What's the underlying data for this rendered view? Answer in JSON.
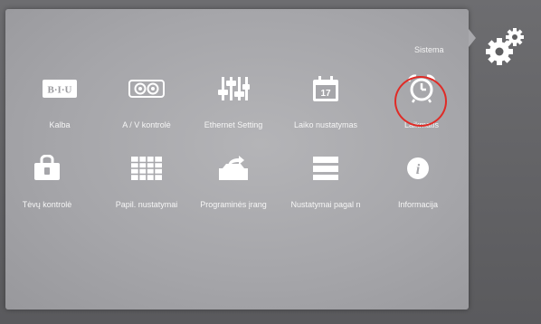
{
  "menu": {
    "section_title": "Sistema",
    "items": [
      {
        "label": "Kalba",
        "icon": "biu-text-icon"
      },
      {
        "label": "A / V kontrolė",
        "icon": "av-speakers-icon"
      },
      {
        "label": "Ethernet Setting",
        "icon": "equalizer-sliders-icon"
      },
      {
        "label": "Laiko nustatymas",
        "icon": "calendar-icon",
        "calendar_day": "17"
      },
      {
        "label": "Laikmatis",
        "icon": "alarm-clock-icon"
      },
      {
        "label": "Tėvų kontrolė",
        "icon": "lock-case-icon"
      },
      {
        "label": "Papil. nustatymai",
        "icon": "grid-table-icon"
      },
      {
        "label": "Programinės įrang",
        "icon": "software-update-icon"
      },
      {
        "label": "Nustatymai pagal n",
        "icon": "reset-stack-icon"
      },
      {
        "label": "Informacija",
        "icon": "info-icon"
      }
    ]
  },
  "icon_text": {
    "biu": "B·I·U",
    "info": "i"
  },
  "colors": {
    "icon": "#ffffff",
    "label": "#f6f6f6",
    "highlight_ring": "#e02b26",
    "panel": "#a6a6aa"
  }
}
